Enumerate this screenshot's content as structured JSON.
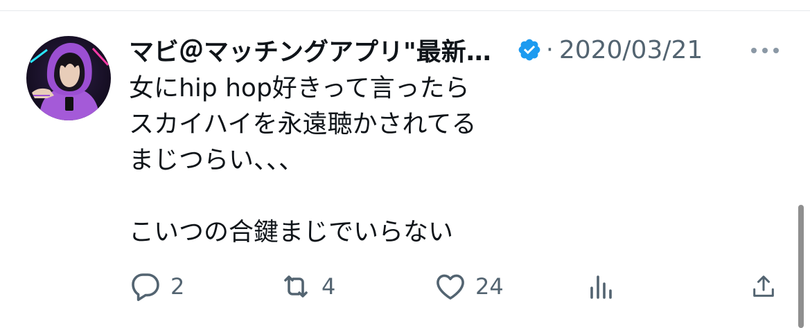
{
  "tweet": {
    "display_name": "マビ＠マッチングアプリ\"最新ネタ\"",
    "separator": "·",
    "date": "2020/03/21",
    "verified": true,
    "lines": [
      "女にhip hop好きって言ったら",
      "スカイハイを永遠聴かされてる",
      "まじつらい、、、",
      "",
      "こいつの合鍵まじでいらない"
    ]
  },
  "actions": {
    "reply_count": "2",
    "retweet_count": "4",
    "like_count": "24"
  },
  "icons": {
    "verified": "verified-badge-icon",
    "more": "more-horizontal-icon",
    "reply": "reply-icon",
    "retweet": "retweet-icon",
    "like": "heart-icon",
    "views": "analytics-icon",
    "share": "share-icon"
  },
  "colors": {
    "verified_blue": "#1d9bf0",
    "secondary_text": "#536471",
    "primary_text": "#0f1419",
    "avatar_hoodie": "#a45ad8"
  }
}
